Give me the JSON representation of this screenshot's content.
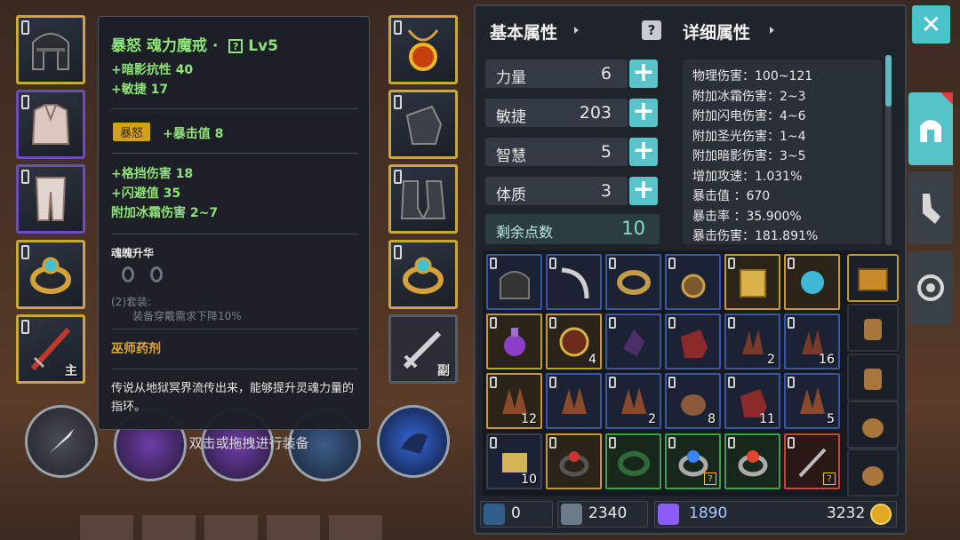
{
  "tooltip": {
    "item_name": "暴怒 魂力魔戒 · ",
    "help_glyph": "?",
    "level": "Lv5",
    "base_stats": [
      "+暗影抗性 40",
      "+敏捷 17"
    ],
    "rage_badge": "暴怒",
    "rage_stat": "+暴击值 8",
    "extra_stats": [
      "+格挡伤害 18",
      "+闪避值 35",
      "附加冰霜伤害 2~7"
    ],
    "soul_title": "魂魄升华",
    "set_line1": "(2)套装:",
    "set_line2": "装备穿戴需求下降10%",
    "source": "巫师药剂",
    "description": "传说从地狱冥界流传出来，能够提升灵魂力量的指环。"
  },
  "equipment": {
    "left_slots": [
      {
        "icon": "helmet-icon"
      },
      {
        "icon": "chest-armor-icon"
      },
      {
        "icon": "leg-armor-icon"
      },
      {
        "icon": "ring-icon"
      },
      {
        "icon": "sword-icon",
        "tag": "主"
      }
    ],
    "right_slots": [
      {
        "icon": "amulet-icon"
      },
      {
        "icon": "gauntlet-icon"
      },
      {
        "icon": "boots-icon"
      },
      {
        "icon": "ring-icon"
      },
      {
        "icon": "sword-icon",
        "tag": "副"
      }
    ]
  },
  "hint_text": "双击或拖拽进行装备",
  "basic": {
    "title": "基本属性",
    "rows": [
      {
        "label": "力量",
        "value": "6"
      },
      {
        "label": "敏捷",
        "value": "203"
      },
      {
        "label": "智慧",
        "value": "5"
      },
      {
        "label": "体质",
        "value": "3"
      }
    ],
    "remaining_label": "剩余点数",
    "remaining_value": "10",
    "plus": "+"
  },
  "detail": {
    "title": "详细属性",
    "lines": [
      "物理伤害：100~121",
      "附加冰霜伤害：2~3",
      "附加闪电伤害：4~6",
      "附加圣光伤害：1~4",
      "附加暗影伤害：3~5",
      "增加攻速：1.031%",
      "暴击值 ：670",
      "暴击率 ：35.900%",
      "暴击伤害：181.891%"
    ]
  },
  "inventory": {
    "counts": [
      "",
      "",
      "",
      "",
      "",
      "",
      "",
      "4",
      "",
      "",
      "2",
      "16",
      "12",
      "",
      "2",
      "8",
      "11",
      "5",
      "10",
      "",
      "",
      "?",
      "",
      "?"
    ]
  },
  "currency": {
    "crystals": "0",
    "silver": "2340",
    "gems": "1890",
    "gold": "3232"
  },
  "close_glyph": "✕"
}
